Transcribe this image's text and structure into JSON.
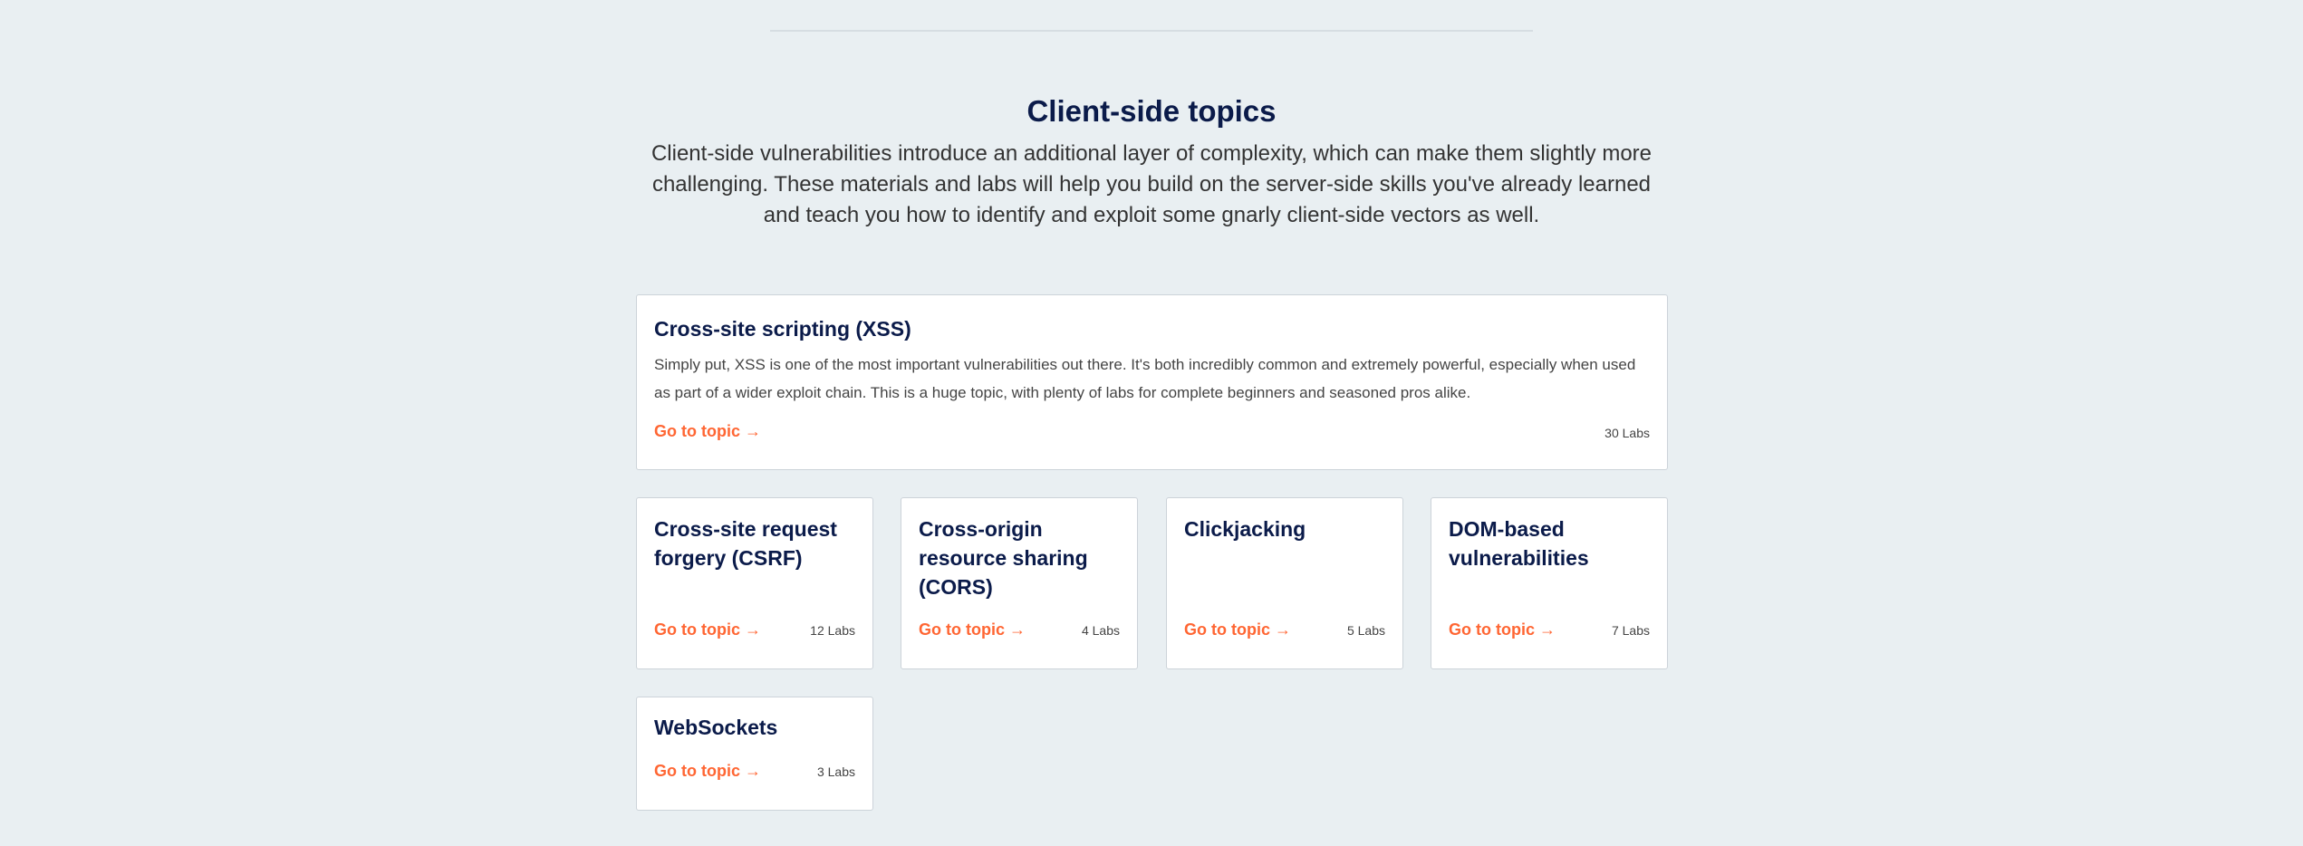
{
  "section": {
    "title": "Client-side topics",
    "description": "Client-side vulnerabilities introduce an additional layer of complexity, which can make them slightly more challenging. These materials and labs will help you build on the server-side skills you've already learned and teach you how to identify and exploit some gnarly client-side vectors as well."
  },
  "colors": {
    "background": "#e9eff2",
    "title": "#0b1b4a",
    "link": "#ff6633",
    "card": "#ffffff"
  },
  "link_arrow_icon": "arrow-right-icon",
  "featured": {
    "title": "Cross-site scripting (XSS)",
    "description": "Simply put, XSS is one of the most important vulnerabilities out there. It's both incredibly common and extremely powerful, especially when used as part of a wider exploit chain. This is a huge topic, with plenty of labs for complete beginners and seasoned pros alike.",
    "link_label": "Go to topic →",
    "labs": "30 Labs"
  },
  "topics": [
    {
      "title": "Cross-site request forgery (CSRF)",
      "link_label": "Go to topic →",
      "labs": "12 Labs"
    },
    {
      "title": "Cross-origin resource sharing (CORS)",
      "link_label": "Go to topic →",
      "labs": "4 Labs"
    },
    {
      "title": "Clickjacking",
      "link_label": "Go to topic →",
      "labs": "5 Labs"
    },
    {
      "title": "DOM-based vulnerabilities",
      "link_label": "Go to topic →",
      "labs": "7 Labs"
    },
    {
      "title": "WebSockets",
      "link_label": "Go to topic →",
      "labs": "3 Labs"
    }
  ]
}
